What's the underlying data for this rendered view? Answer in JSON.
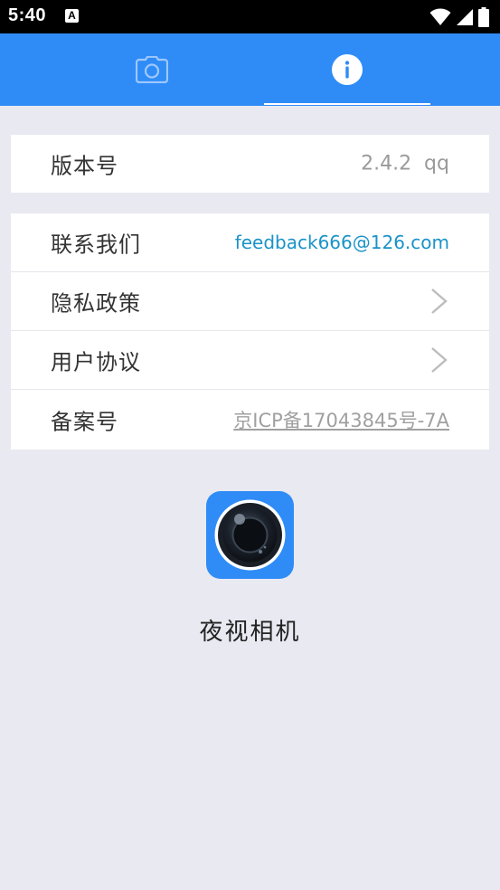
{
  "status_bar": {
    "time": "5:40",
    "notification_icon_letter": "A",
    "icons": [
      "wifi-icon",
      "signal-icon",
      "battery-icon"
    ]
  },
  "tabs": [
    {
      "icon": "camera-icon",
      "selected": false
    },
    {
      "icon": "info-icon",
      "selected": true
    }
  ],
  "version": {
    "label": "版本号",
    "value": "2.4.2  qq"
  },
  "list": {
    "contact": {
      "label": "联系我们",
      "value": "feedback666@126.com"
    },
    "privacy": {
      "label": "隐私政策"
    },
    "agreement": {
      "label": "用户协议"
    },
    "filing": {
      "label": "备案号",
      "value": "京ICP备17043845号-7A"
    }
  },
  "app": {
    "name": "夜视相机",
    "logo_icon": "camera-lens-icon"
  },
  "colors": {
    "accent": "#2f8cf7",
    "link": "#1a93c8",
    "background": "#e9e9f2"
  }
}
